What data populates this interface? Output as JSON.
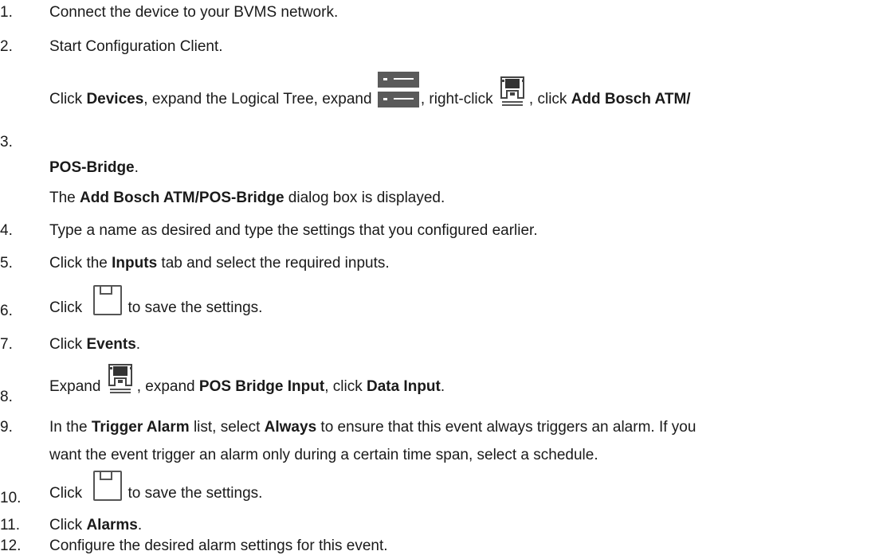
{
  "steps": [
    {
      "n": "1.",
      "text": "Connect the device to your BVMS network."
    },
    {
      "n": "2.",
      "text": "Start Configuration Client."
    },
    {
      "n": "3.",
      "a": "Click ",
      "b": "Devices",
      "c": ", expand the Logical Tree, expand ",
      "d": ", right-click ",
      "e": ", click ",
      "f": "Add Bosch ATM/",
      "g": "POS-Bridge",
      "h": ".",
      "note_a": "The ",
      "note_b": "Add Bosch ATM/POS-Bridge",
      "note_c": " dialog box is displayed."
    },
    {
      "n": "4.",
      "text": "Type a name as desired and type the settings that you configured earlier."
    },
    {
      "n": "5.",
      "a": "Click the ",
      "b": "Inputs",
      "c": " tab and select the required inputs."
    },
    {
      "n": "6.",
      "a": "Click ",
      "c": "to save the settings."
    },
    {
      "n": "7.",
      "a": "Click ",
      "b": "Events",
      "c": "."
    },
    {
      "n": "8.",
      "a": "Expand ",
      "c": ", expand ",
      "d": "POS Bridge Input",
      "e": ", click ",
      "f": "Data Input",
      "g": "."
    },
    {
      "n": "9.",
      "a": "In the ",
      "b": "Trigger Alarm",
      "c": " list, select ",
      "d": "Always",
      "e": " to ensure that this event always triggers an alarm. If you",
      "line2": "want the event trigger an alarm only during a certain time span, select a schedule."
    },
    {
      "n": "10.",
      "a": "Click ",
      "c": "to save the settings."
    },
    {
      "n": "11.",
      "a": "Click ",
      "b": "Alarms",
      "c": "."
    },
    {
      "n": "12.",
      "text": "Configure the desired alarm settings for this event."
    }
  ],
  "icons": {
    "logical_tree": "list-tree-icon",
    "atm_pos": "atm-pos-bridge-icon",
    "save": "save-icon"
  }
}
